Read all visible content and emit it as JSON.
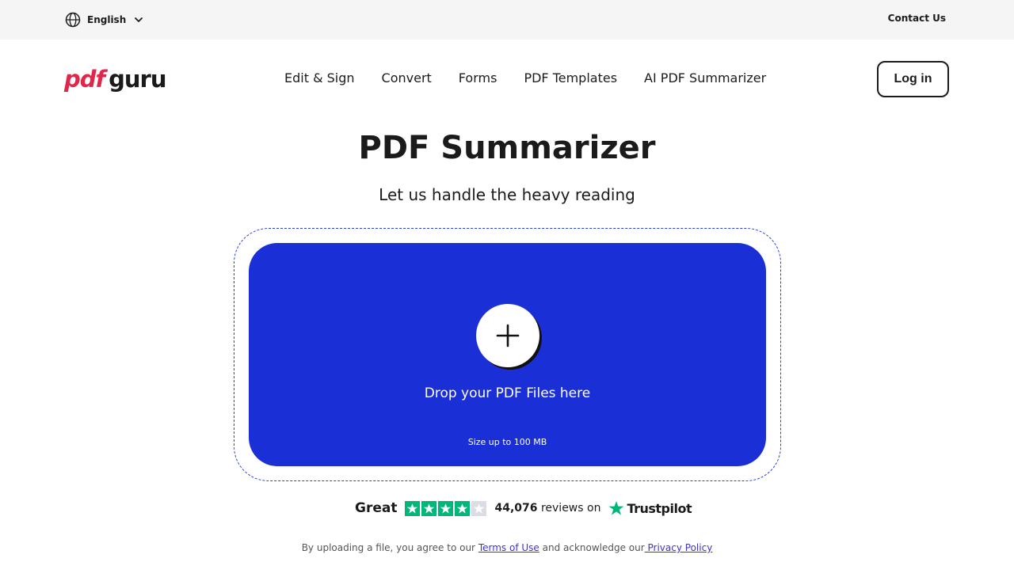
{
  "topbar": {
    "language": "English",
    "contact": "Contact Us"
  },
  "header": {
    "logo_part1": "pdf",
    "logo_part2": "guru",
    "nav": [
      "Edit & Sign",
      "Convert",
      "Forms",
      "PDF Templates",
      "AI PDF Summarizer"
    ],
    "login": "Log in"
  },
  "hero": {
    "title": "PDF Summarizer",
    "subtitle": "Let us handle the heavy reading"
  },
  "upload": {
    "drop_text": "Drop your PDF Files here",
    "size_text": "Size up to 100 MB",
    "icon": "plus-icon"
  },
  "rating": {
    "label": "Great",
    "stars_filled": 4,
    "stars_total": 5,
    "review_count": "44,076",
    "reviews_suffix": "reviews on",
    "platform": "Trustpilot"
  },
  "legal": {
    "prefix": "By uploading a file, you agree to our",
    "terms": "Terms of Use",
    "middle": "and acknowledge our",
    "privacy": " Privacy Policy"
  },
  "colors": {
    "accent_blue": "#1a2fd6",
    "logo_red": "#e0274a",
    "star_green": "#00b67a",
    "link": "#3f30d9"
  }
}
